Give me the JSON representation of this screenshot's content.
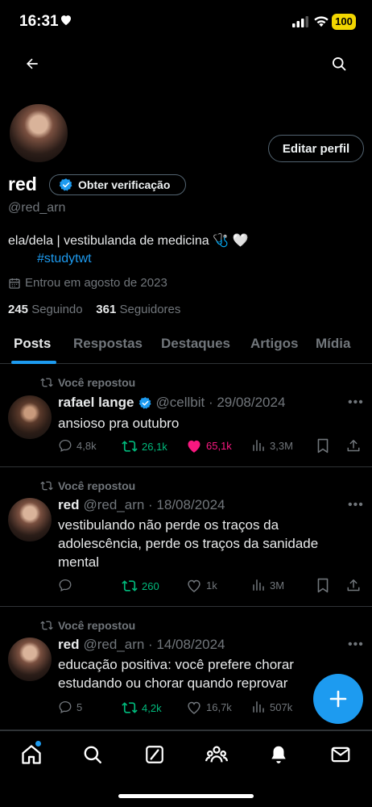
{
  "status": {
    "time": "16:31",
    "battery": "100"
  },
  "profile": {
    "edit_label": "Editar perfil",
    "name": "red",
    "verify_label": "Obter verificação",
    "handle": "@red_arn",
    "bio": "ela/dela | vestibulanda de medicina 🩺 🤍",
    "bio_tag": "#studytwt",
    "joined": "Entrou em agosto de 2023",
    "following_count": "245",
    "following_label": "Seguindo",
    "followers_count": "361",
    "followers_label": "Seguidores"
  },
  "tabs": [
    "Posts",
    "Respostas",
    "Destaques",
    "Artigos",
    "Mídia"
  ],
  "posts": [
    {
      "repost_label": "Você repostou",
      "name": "rafael lange",
      "verified": true,
      "meta": "@cellbit · 29/08/2024",
      "text": "ansioso pra outubro",
      "replies": "4,8k",
      "reposts": "26,1k",
      "likes": "65,1k",
      "views": "3,3M",
      "liked": true
    },
    {
      "repost_label": "Você repostou",
      "name": "red",
      "verified": false,
      "meta": "@red_arn · 18/08/2024",
      "text": "vestibulando não perde os traços da adolescência, perde os traços da sanidade mental",
      "replies": "",
      "reposts": "260",
      "likes": "1k",
      "views": "3M",
      "liked": false
    },
    {
      "repost_label": "Você repostou",
      "name": "red",
      "verified": false,
      "meta": "@red_arn · 14/08/2024",
      "text": "educação positiva: você prefere chorar estudando ou chorar quando reprovar",
      "replies": "5",
      "reposts": "4,2k",
      "likes": "16,7k",
      "views": "507k",
      "liked": false
    }
  ],
  "colors": {
    "accent": "#1d9bf0",
    "repost_green": "#00ba7c",
    "like_pink": "#f91880",
    "muted": "#71767b",
    "battery": "#f2d600"
  }
}
